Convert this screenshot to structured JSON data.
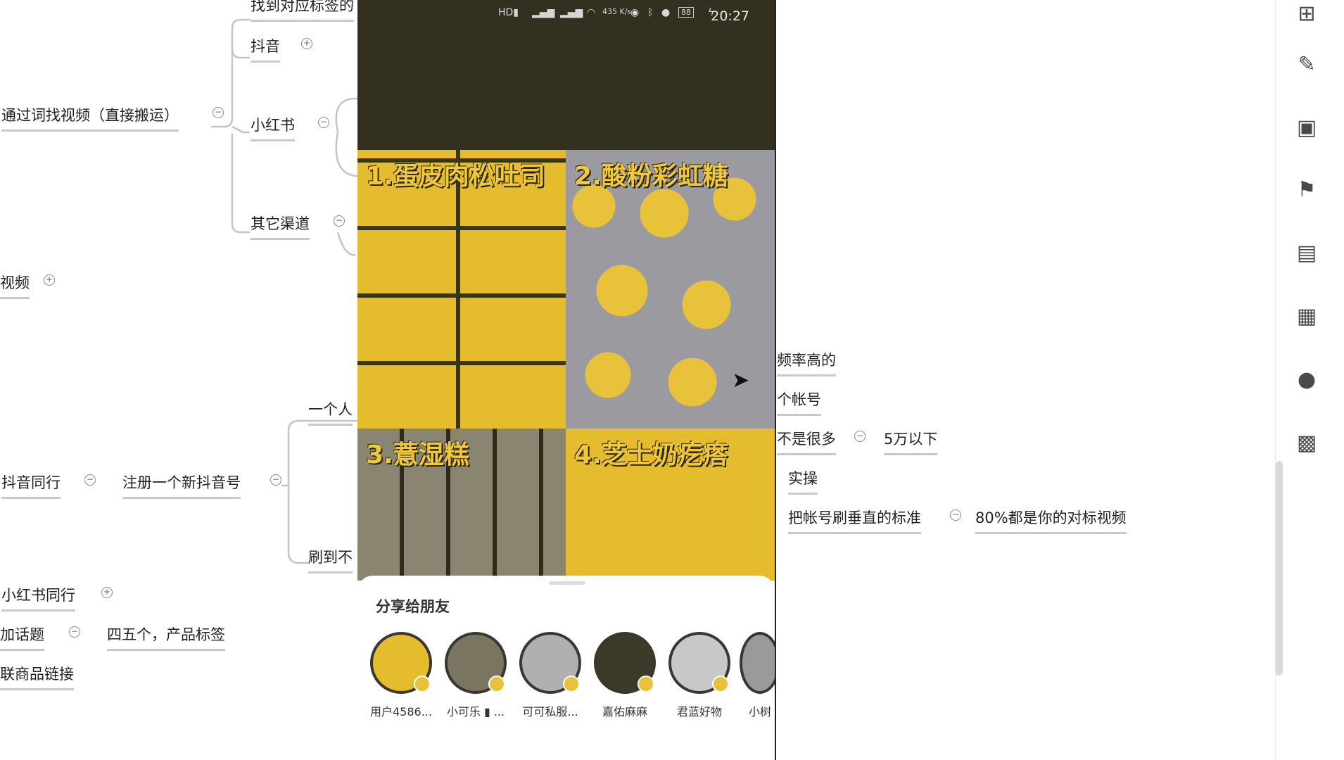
{
  "mindmap": {
    "n_top_cut": "找到对应标签的",
    "n_douyin": "抖音",
    "n_find_video": "通过词找视频（直接搬运）",
    "n_xiaohongshu": "小红书",
    "n_other": "其它渠道",
    "n_video": "视频",
    "n_one_person": "一个人",
    "n_douyin_peer": "抖音同行",
    "n_register": "注册一个新抖音号",
    "n_swipe": "刷到不",
    "n_xhs_peer": "小红书同行",
    "n_add_topic": "加话题",
    "n_four_five": "四五个，产品标签",
    "n_link": "联商品链接",
    "n_freq": "频率高的",
    "n_account": "个帐号",
    "n_not_many": "不是很多",
    "n_50k": "5万以下",
    "n_practice": "实操",
    "n_vertical": "把帐号刷垂直的标准",
    "n_80": "80%都是你的对标视频"
  },
  "phone": {
    "time": "20:27",
    "battery": "88",
    "net_speed": "435 K/s",
    "cells": [
      "1.蛋皮肉松吐司",
      "2.酸粉彩虹糖",
      "3.薏湿糕",
      "4.芝士奶疙瘩"
    ],
    "share_title": "分享给朋友",
    "friends": [
      "用户4586...",
      "小可乐 ▮ ...",
      "可可私服...",
      "嘉佑麻麻",
      "君蓝好物",
      "小树"
    ]
  },
  "colors": {
    "accent_yellow": "#e8c23a",
    "statusbar": "#34301f"
  },
  "toolbar_icons": [
    "structure-icon",
    "brush-icon",
    "image-icon",
    "flag-icon",
    "formula-icon",
    "document-icon",
    "comment-icon",
    "clipboard-icon"
  ]
}
